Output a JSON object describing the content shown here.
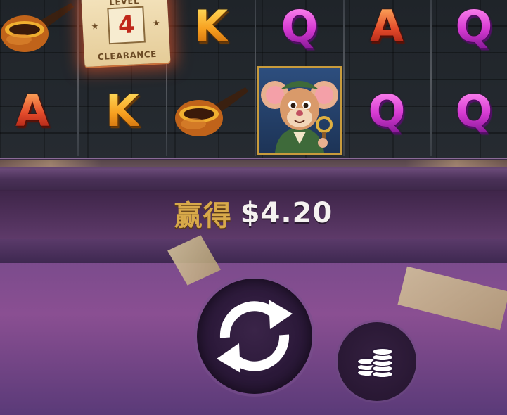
{
  "reels": {
    "level_card": {
      "label": "LEVEL",
      "number": "4",
      "caption": "CLEARANCE"
    },
    "letters": {
      "r1c3": "K",
      "r1c4": "Q",
      "r1c5": "A",
      "r1c6": "Q",
      "r2c1": "A",
      "r2c2": "K",
      "r2c5": "Q",
      "r2c6": "Q"
    }
  },
  "win": {
    "label": "赢得",
    "amount": "$4.20"
  },
  "controls": {
    "spin_icon": "refresh-arrows-icon",
    "stack_icon": "coin-stack-icon"
  },
  "colors": {
    "accent_gold": "#d8a94a",
    "panel_purple": "#6a4a82"
  }
}
